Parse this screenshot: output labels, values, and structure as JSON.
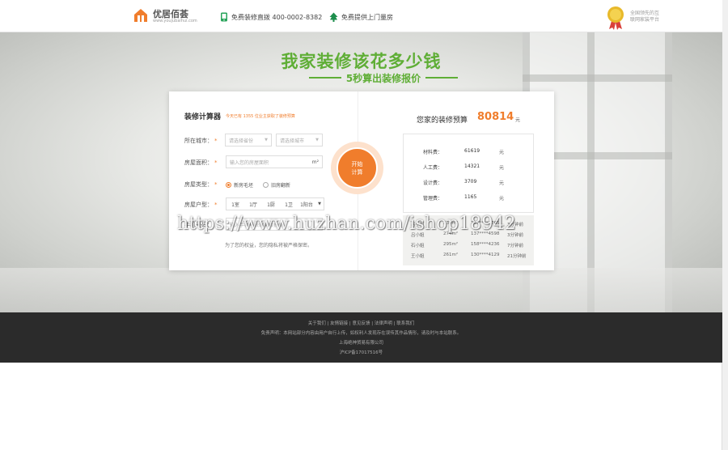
{
  "header": {
    "logo_name": "优居佰荟",
    "logo_url": "www.youjubaihui.com",
    "phone_text": "免费装修直拨 400-0002-8382",
    "measure_text": "免费提供上门量房",
    "badge_line1": "全国领先的互",
    "badge_line2": "联网家装平台",
    "icons": {
      "logo": "house-logo-icon",
      "phone": "phone-icon",
      "measure": "house-tree-icon",
      "badge": "medal-icon"
    },
    "colors": {
      "logo_orange": "#f07d2c",
      "phone_green": "#27a35a",
      "tree_green": "#1f8f4e",
      "medal_gold": "#e8b92a"
    }
  },
  "hero": {
    "headline": "我家装修该花多少钱",
    "subline": "5秒算出装修报价",
    "accent_green": "#5fae36"
  },
  "calculator": {
    "title": "装修计算器",
    "note": "今天已有 1355 位业主获取了装修预算",
    "city_label": "所在城市：",
    "province_placeholder": "请选择省份",
    "city_placeholder": "请选择城市",
    "area_label": "房屋面积：",
    "area_placeholder": "输入您的房屋面积",
    "area_unit": "m²",
    "type_label": "房屋类型：",
    "type_options": [
      "新房毛坯",
      "旧房翻新"
    ],
    "type_selected": "新房毛坯",
    "layout_label": "房屋户型：",
    "layout_values": [
      "1室",
      "1厅",
      "1厨",
      "1卫",
      "1阳台"
    ],
    "phone_label": "手机号码：",
    "phone_placeholder": "输入手机号获取装修报价",
    "privacy_text": "为了您的权益，您的隐私将被严格保密。",
    "required_mark": "*",
    "start_line1": "开始",
    "start_line2": "计算",
    "accent_orange": "#f07d2c"
  },
  "result": {
    "budget_label": "您家的装修预算",
    "budget_value": "80814",
    "budget_unit": "元",
    "items": [
      {
        "name": "材料费：",
        "value": "61619",
        "unit": "元"
      },
      {
        "name": "人工费：",
        "value": "14321",
        "unit": "元"
      },
      {
        "name": "设计费：",
        "value": "3709",
        "unit": "元"
      },
      {
        "name": "管理费：",
        "value": "1165",
        "unit": "元"
      }
    ]
  },
  "cases": [
    {
      "name": "吕小姐",
      "area": "230m²",
      "phone": "131****2765",
      "time": "3分钟前"
    },
    {
      "name": "吕小姐",
      "area": "274m²",
      "phone": "137****4598",
      "time": "3分钟前"
    },
    {
      "name": "石小姐",
      "area": "295m²",
      "phone": "158****4236",
      "time": "7分钟前"
    },
    {
      "name": "王小姐",
      "area": "261m²",
      "phone": "130****4129",
      "time": "21分钟前"
    }
  ],
  "watermark": "https://www.huzhan.com/ishop18942",
  "footer": {
    "links": "关于我们 | 友情链接 | 意见反馈 | 法律声明 | 联系我们",
    "disclaimer": "免责声明：本网站部分内容由用户自行上传，如权利人发现存在误传其作品情形，请及时与本站联系。",
    "company": "上海绝神贸易有限公司",
    "icp": "沪ICP备17017516号"
  }
}
